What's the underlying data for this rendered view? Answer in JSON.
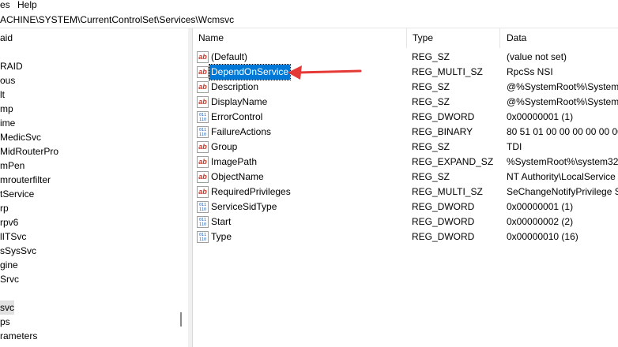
{
  "menu": {
    "items": [
      "es",
      "Help"
    ]
  },
  "address": "ACHINE\\SYSTEM\\CurrentControlSet\\Services\\Wcmsvc",
  "tree": {
    "items": [
      "aid",
      "",
      "RAID",
      "ous",
      "lt",
      "mp",
      "ime",
      "MedicSvc",
      "MidRouterPro",
      "mPen",
      "mrouterfilter",
      "tService",
      "rp",
      "rpv6",
      "lITSvc",
      "sSysSvc",
      "gine",
      "Srvc",
      "",
      "svc",
      "ps",
      "rameters"
    ]
  },
  "columns": {
    "name": "Name",
    "type": "Type",
    "data": "Data"
  },
  "rows": [
    {
      "icon": "string-value-icon",
      "name": "(Default)",
      "type": "REG_SZ",
      "data": "(value not set)"
    },
    {
      "icon": "string-value-icon",
      "name": "DependOnService",
      "type": "REG_MULTI_SZ",
      "data": "RpcSs NSI"
    },
    {
      "icon": "string-value-icon",
      "name": "Description",
      "type": "REG_SZ",
      "data": "@%SystemRoot%\\System"
    },
    {
      "icon": "string-value-icon",
      "name": "DisplayName",
      "type": "REG_SZ",
      "data": "@%SystemRoot%\\System"
    },
    {
      "icon": "binary-value-icon",
      "name": "ErrorControl",
      "type": "REG_DWORD",
      "data": "0x00000001 (1)"
    },
    {
      "icon": "binary-value-icon",
      "name": "FailureActions",
      "type": "REG_BINARY",
      "data": "80 51 01 00 00 00 00 00 00 ("
    },
    {
      "icon": "string-value-icon",
      "name": "Group",
      "type": "REG_SZ",
      "data": "TDI"
    },
    {
      "icon": "string-value-icon",
      "name": "ImagePath",
      "type": "REG_EXPAND_SZ",
      "data": "%SystemRoot%\\system32\\"
    },
    {
      "icon": "string-value-icon",
      "name": "ObjectName",
      "type": "REG_SZ",
      "data": "NT Authority\\LocalService"
    },
    {
      "icon": "string-value-icon",
      "name": "RequiredPrivileges",
      "type": "REG_MULTI_SZ",
      "data": "SeChangeNotifyPrivilege S"
    },
    {
      "icon": "binary-value-icon",
      "name": "ServiceSidType",
      "type": "REG_DWORD",
      "data": "0x00000001 (1)"
    },
    {
      "icon": "binary-value-icon",
      "name": "Start",
      "type": "REG_DWORD",
      "data": "0x00000002 (2)"
    },
    {
      "icon": "binary-value-icon",
      "name": "Type",
      "type": "REG_DWORD",
      "data": "0x00000010 (16)"
    }
  ],
  "selected_row": 1,
  "colors": {
    "selection": "#0078d7",
    "arrow": "#e53935",
    "sz_icon": "#c0392b",
    "bin_icon": "#1f5fb3"
  }
}
